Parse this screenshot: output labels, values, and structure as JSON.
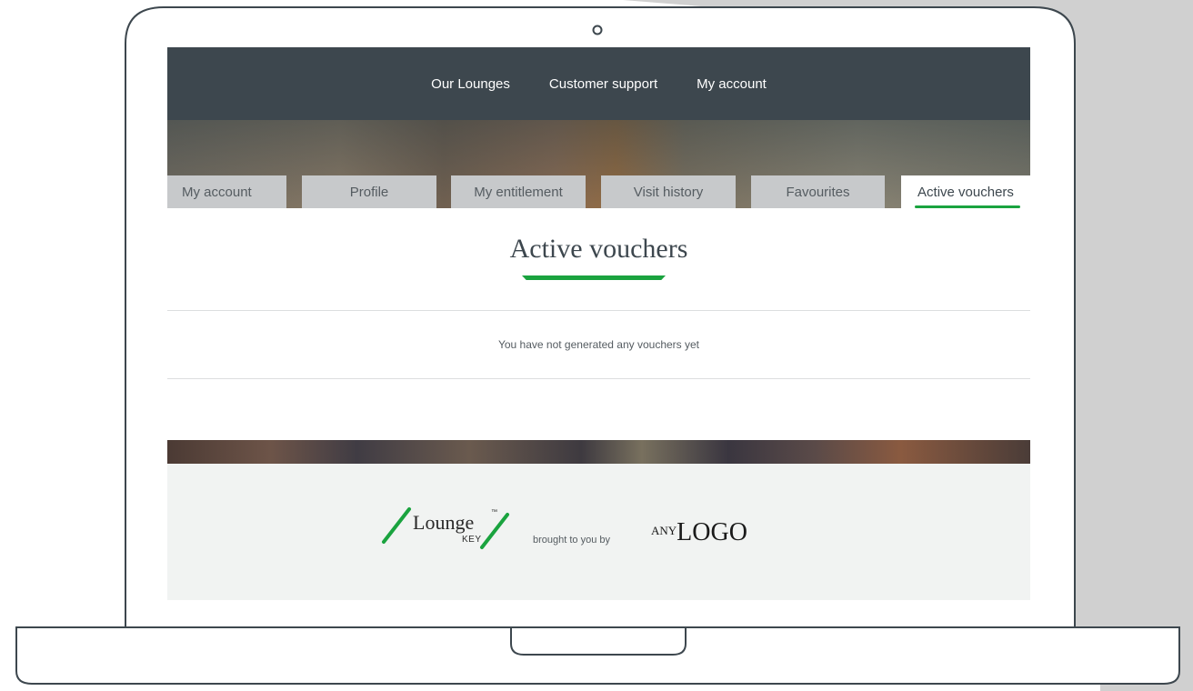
{
  "top_nav": {
    "items": [
      "Our Lounges",
      "Customer support",
      "My account"
    ]
  },
  "tabs": [
    {
      "label": "My account",
      "active": false
    },
    {
      "label": "Profile",
      "active": false
    },
    {
      "label": "My entitlement",
      "active": false
    },
    {
      "label": "Visit history",
      "active": false
    },
    {
      "label": "Favourites",
      "active": false
    },
    {
      "label": "Active vouchers",
      "active": true
    }
  ],
  "main": {
    "title": "Active vouchers",
    "empty_message": "You have not generated any vouchers yet"
  },
  "footer": {
    "brand_logo_text": "Lounge",
    "brand_logo_tm": "™",
    "brand_logo_sub": "KEY",
    "brought_text": "brought to you by",
    "partner_logo_small": "ANY",
    "partner_logo_big": "LOGO"
  },
  "colors": {
    "accent": "#1aa33f",
    "nav_bg": "#3d474e",
    "tab_bg": "#c7c9cb",
    "footer_bg": "#f1f3f2",
    "frame_stroke": "#3d474e",
    "backdrop_gray": "#d0d0d0"
  }
}
